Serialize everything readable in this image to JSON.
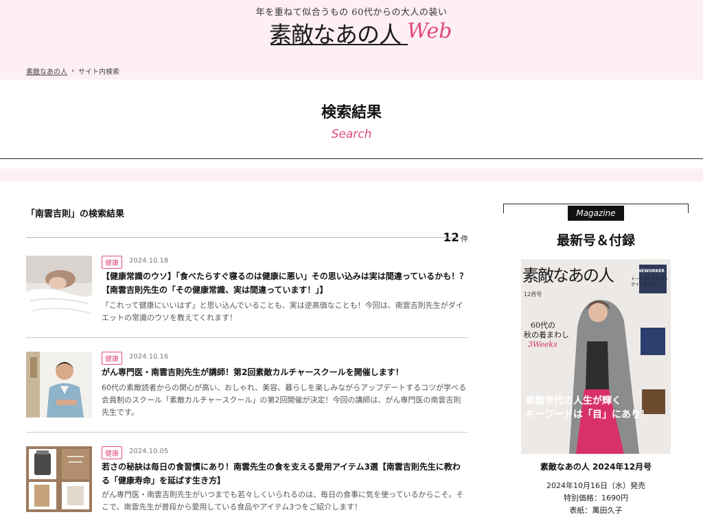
{
  "header": {
    "tagline": "年を重ねて似合うもの 60代からの大人の装い",
    "logo_jp": "素敵なあの人",
    "logo_web": "Web"
  },
  "breadcrumb": {
    "home": "素敵なあの人",
    "separator": "›",
    "current": "サイト内検索"
  },
  "page": {
    "title": "検索結果",
    "subtitle": "Search"
  },
  "results": {
    "heading": "「南雲吉則」の検索結果",
    "count": "12",
    "count_unit": "件",
    "items": [
      {
        "category": "健康",
        "date": "2024.10.18",
        "title": "【健康常識のウソ】「食べたらすぐ寝るのは健康に悪い」その思い込みは実は間違っているかも！？【南雲吉則先生の「その健康常識、実は間違っています！」】",
        "excerpt": "「これって健康にいいはず」と思い込んでいることも、実は逆高価なことも！今回は、南雲吉則先生がダイエットの常識のウソを教えてくれます！"
      },
      {
        "category": "健康",
        "date": "2024.10.16",
        "title": "がん専門医・南雲吉則先生が講師！第2回素敵カルチャースクールを開催します！",
        "excerpt": "60代の素敵読者からの関心が高い、おしゃれ、美容、暮らしを楽しみながらアップデートするコツが学べる会員制のスクール「素敵カルチャースクール」の第2回開催が決定！今回の講師は、がん専門医の南雲吉則先生です。"
      },
      {
        "category": "健康",
        "date": "2024.10.05",
        "title": "若さの秘訣は毎日の食習慣にあり！南雲先生の食を支える愛用アイテム3選【南雲吉則先生に教わる「健康寿命」を延ばす生き方】",
        "excerpt": "がん専門医・南雲吉則先生がいつまでも若々しくいられるのは、毎日の食事に気を使っているからこそ。そこで、南雲先生が普段から愛用している食品やアイテム3つをご紹介します！"
      }
    ]
  },
  "sidebar": {
    "label": "Magazine",
    "heading": "最新号＆付録",
    "cover": {
      "title": "素敵なあの人",
      "badge": "NEWORKER",
      "issue": "12月号",
      "feature1": "60代の",
      "feature2": "秋の着まわし",
      "weeks": "3Weeks",
      "headline1": "素敵世代の人生が輝く",
      "headline2": "キーワードは「目」にあり！",
      "bag_label": "トートバッグ＆バッグインポーチ"
    },
    "issue_name": "素敵なあの人 2024年12月号",
    "release": "2024年10月16日（水）発売",
    "price": "特別価格：1690円",
    "cover_person": "表紙：萬田久子"
  }
}
